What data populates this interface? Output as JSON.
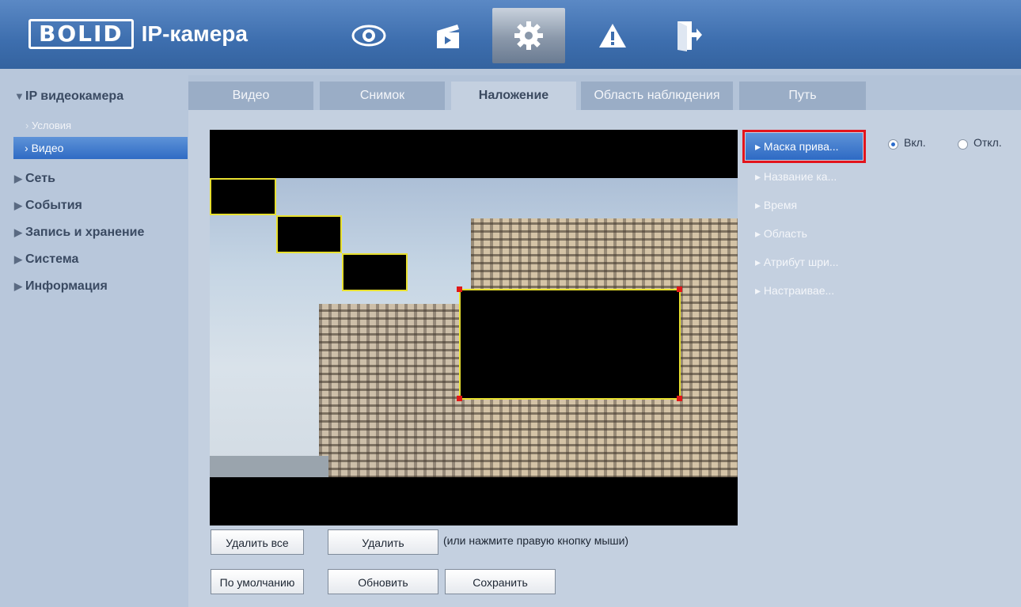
{
  "header": {
    "logo_brand": "BOLID",
    "logo_product": "IP-камера",
    "nav_icons": [
      "eye-icon",
      "clapperboard-icon",
      "gear-icon",
      "warning-icon",
      "exit-icon"
    ],
    "active_icon": "gear-icon"
  },
  "sidebar": {
    "items": [
      {
        "label": "IP видеокамера",
        "expanded": true
      },
      {
        "label": "Сеть"
      },
      {
        "label": "События"
      },
      {
        "label": "Запись и хранение"
      },
      {
        "label": "Система"
      },
      {
        "label": "Информация"
      }
    ],
    "sub": {
      "conditions": "Условия",
      "video": "Видео"
    }
  },
  "tabs": [
    "Видео",
    "Снимок",
    "Наложение",
    "Область наблюдения",
    "Путь"
  ],
  "active_tab": "Наложение",
  "overlay_menu": [
    "Маска прива...",
    "Название ка...",
    "Время",
    "Область",
    "Атрибут шри...",
    "Настраивае..."
  ],
  "selected_menu": "Маска прива...",
  "privacy_mask": {
    "on_label": "Вкл.",
    "off_label": "Откл.",
    "enabled": true
  },
  "buttons": {
    "delete_all": "Удалить все",
    "delete": "Удалить",
    "hint": "(или нажмите правую кнопку мыши)",
    "default": "По умолчанию",
    "refresh": "Обновить",
    "save": "Сохранить"
  },
  "colors": {
    "header": "#3d6eae",
    "accent": "#2f6bc4",
    "highlight": "#e3141c",
    "mask_border": "#e8e030"
  }
}
